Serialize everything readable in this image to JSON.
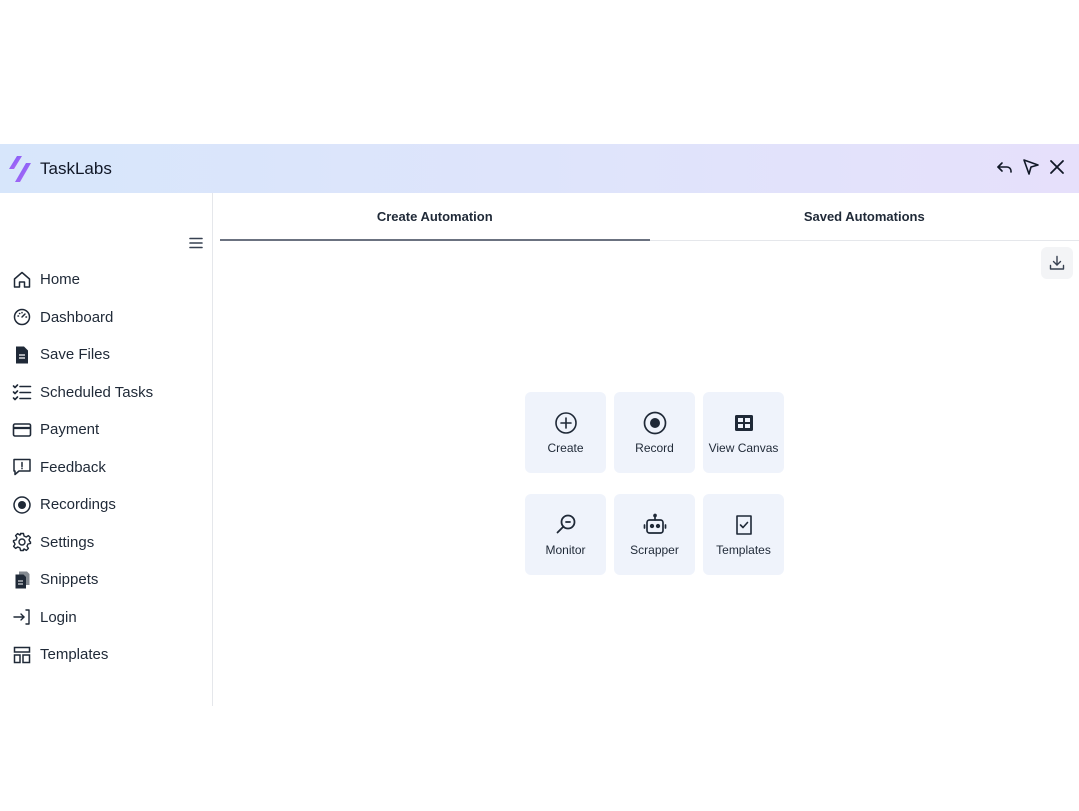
{
  "app": {
    "title": "TaskLabs"
  },
  "sidebar": {
    "items": [
      {
        "label": "Home",
        "icon": "home-icon"
      },
      {
        "label": "Dashboard",
        "icon": "gauge-icon"
      },
      {
        "label": "Save Files",
        "icon": "file-icon"
      },
      {
        "label": "Scheduled Tasks",
        "icon": "checklist-icon"
      },
      {
        "label": "Payment",
        "icon": "credit-card-icon"
      },
      {
        "label": "Feedback",
        "icon": "feedback-icon"
      },
      {
        "label": "Recordings",
        "icon": "record-icon"
      },
      {
        "label": "Settings",
        "icon": "gear-icon"
      },
      {
        "label": "Snippets",
        "icon": "snippets-icon"
      },
      {
        "label": "Login",
        "icon": "login-icon"
      },
      {
        "label": "Templates",
        "icon": "templates-icon"
      }
    ]
  },
  "tabs": [
    {
      "label": "Create Automation",
      "active": true
    },
    {
      "label": "Saved Automations",
      "active": false
    }
  ],
  "actions": [
    {
      "label": "Create",
      "icon": "plus-circle-icon"
    },
    {
      "label": "Record",
      "icon": "record-icon"
    },
    {
      "label": "View Canvas",
      "icon": "canvas-icon"
    },
    {
      "label": "Monitor",
      "icon": "magnifier-icon"
    },
    {
      "label": "Scrapper",
      "icon": "robot-icon"
    },
    {
      "label": "Templates",
      "icon": "checkbox-doc-icon"
    }
  ],
  "colors": {
    "titlebar_start": "#d7e6fb",
    "titlebar_end": "#e6e0fb",
    "card_bg": "#eff3fb",
    "logo_accent": "#8b5cf6"
  }
}
